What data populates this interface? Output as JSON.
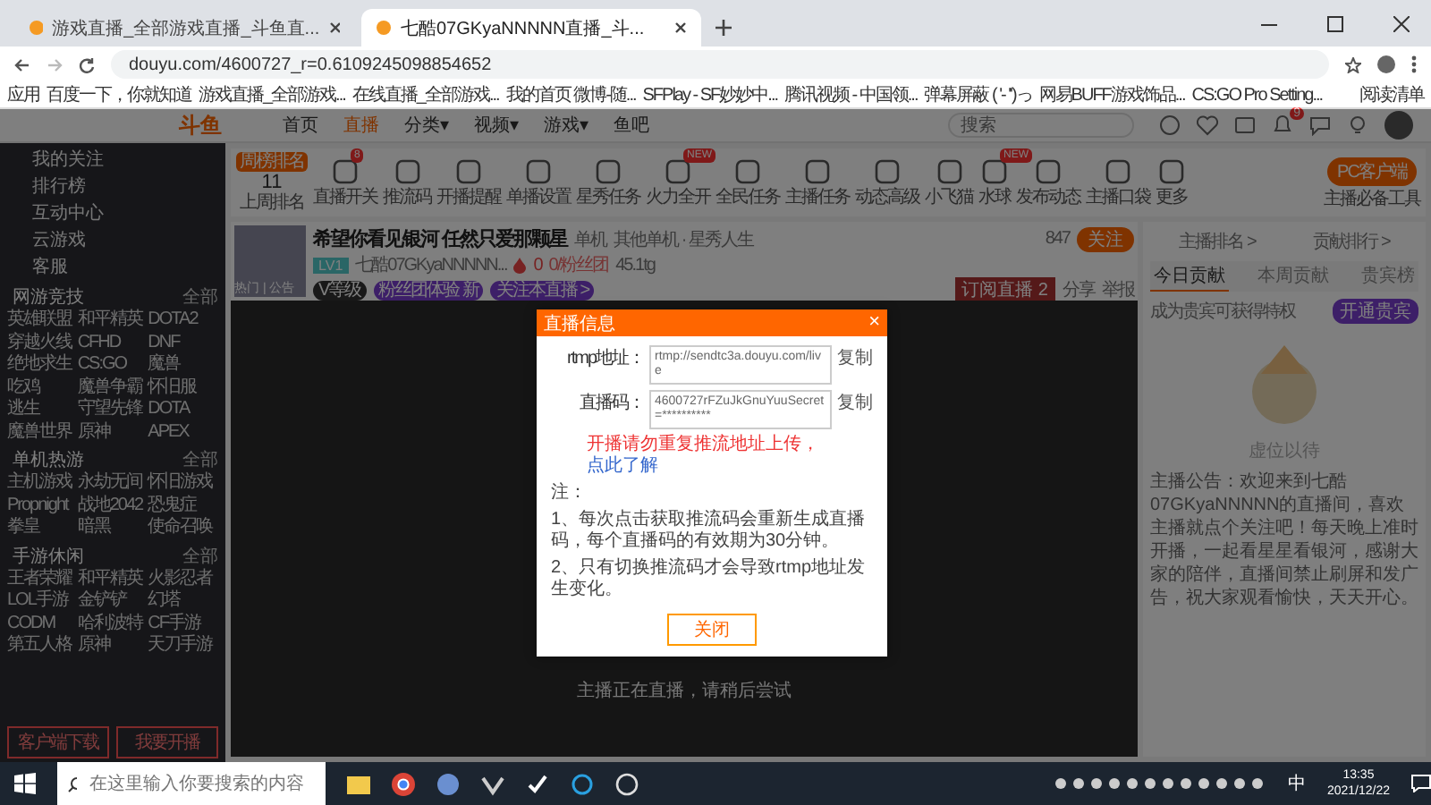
{
  "browser": {
    "tabs": [
      {
        "title": "游戏直播_全部游戏直播_斗鱼直...",
        "selected": false
      },
      {
        "title": "七酷07GKyaNNNNN直播_斗...",
        "selected": true
      }
    ],
    "url": "douyu.com/4600727_r=0.6109245098854652",
    "bookmarks": [
      "应用",
      "百度一下，你就知道",
      "游戏直播_全部游戏...",
      "在线直播_全部游戏...",
      "我的首页 微博-随...",
      "SFPlay - SF妙妙中...",
      "腾讯视频 - 中国领...",
      "弹幕屏蔽 ( '- '')っ",
      "网易BUFF游戏饰品...",
      "CS:GO Pro Setting..."
    ],
    "reading_list": "阅读清单"
  },
  "site_header": {
    "logo": "斗鱼",
    "nav": [
      {
        "label": "首页",
        "selected": false
      },
      {
        "label": "直播",
        "selected": true
      },
      {
        "label": "分类▾",
        "selected": false
      },
      {
        "label": "视频▾",
        "selected": false
      },
      {
        "label": "游戏▾",
        "selected": false
      },
      {
        "label": "鱼吧",
        "selected": false
      }
    ],
    "search": {
      "placeholder": "搜索"
    },
    "notification_badge": "9"
  },
  "sidebar": {
    "items": [
      "我的关注",
      "排行榜",
      "互动中心",
      "云游戏",
      "客服"
    ],
    "sections": [
      {
        "title": "网游竞技",
        "more": "全部",
        "games": [
          "英雄联盟",
          "和平精英",
          "DOTA2",
          "穿越火线",
          "CFHD",
          "DNF",
          "绝地求生",
          "CS:GO",
          "魔兽",
          "吃鸡",
          "魔兽争霸",
          "怀旧服",
          "逃生",
          "守望先锋",
          "DOTA",
          "魔兽世界",
          "原神",
          "APEX"
        ]
      },
      {
        "title": "单机热游",
        "more": "全部",
        "games": [
          "主机游戏",
          "永劫无间",
          "怀旧游戏",
          "Propnight",
          "战地2042",
          "恐鬼症",
          "拳皇",
          "暗黑",
          "使命召唤"
        ]
      },
      {
        "title": "手游休闲",
        "more": "全部",
        "games": [
          "王者荣耀",
          "和平精英",
          "火影忍者",
          "LOL手游",
          "金铲铲",
          "幻塔",
          "CODM",
          "哈利波特",
          "CF手游",
          "第五人格",
          "原神",
          "天刀手游"
        ]
      }
    ],
    "buttons": [
      "客户端下载",
      "我要开播"
    ]
  },
  "activity_bar": {
    "rank_badge": "周榜排名",
    "rank": "11",
    "rank_label": "上周排名",
    "items": [
      {
        "label": "直播开关",
        "badge": "8"
      },
      {
        "label": "推流码"
      },
      {
        "label": "开播提醒"
      },
      {
        "label": "单播设置"
      },
      {
        "label": "星秀任务"
      },
      {
        "label": "火力全开",
        "badge": "NEW"
      },
      {
        "label": "全民任务"
      },
      {
        "label": "主播任务"
      },
      {
        "label": "动态高级"
      },
      {
        "label": "小飞猫"
      },
      {
        "label": "水球",
        "badge": "NEW"
      },
      {
        "label": "发布动态"
      },
      {
        "label": "主播口袋"
      },
      {
        "label": "更多"
      }
    ],
    "pc_button": "PC客户端",
    "pc_caption": "主播必备工具"
  },
  "room": {
    "title": "希望你看见银河 任然只爱那颗星",
    "category": "单机",
    "category_path": "其他单机 · 星秀人生",
    "level_tag": "LV1",
    "streamer": "七酷07GKyaNNNNN...",
    "hot": "0",
    "fans": "0/粉丝团",
    "viewers": "45.1tg",
    "avatar_caption": "热门 | 公告",
    "badges": [
      "V等级",
      "粉丝团体验 新",
      "关注本直播 >"
    ],
    "follow_count": "847",
    "follow_button": "关注",
    "gift_button": "订阅直播 2",
    "share": "分享",
    "report": "举报"
  },
  "player": {
    "message": "主播正在直播，请稍后尝试"
  },
  "right_panel": {
    "tabs_top": [
      "主播排名 >",
      "贡献排行 >"
    ],
    "tabs": [
      {
        "label": "今日贡献",
        "selected": true
      },
      {
        "label": "本周贡献",
        "selected": false
      },
      {
        "label": "贵宾榜",
        "selected": false
      }
    ],
    "hint": "成为贵宾可获得特权",
    "vip_button": "开通贵宾",
    "caption": "虚位以待",
    "notice": "主播公告：欢迎来到七酷07GKyaNNNNN的直播间，喜欢主播就点个关注吧！每天晚上准时开播，一起看星星看银河，感谢大家的陪伴，直播间禁止刷屏和发广告，祝大家观看愉快，天天开心。"
  },
  "dialog": {
    "title": "直播信息",
    "close": "×",
    "rows": [
      {
        "label": "rtmp地址：",
        "value": "rtmp://sendtc3a.douyu.com/live",
        "copy": "复制"
      },
      {
        "label": "直播码：",
        "value": "4600727rFZuJkGnuYuuSecret=**********",
        "copy": "复制"
      }
    ],
    "warning": "开播请勿重复推流地址上传，",
    "warning_link": "点此了解",
    "notes": [
      "注：",
      "1、每次点击获取推流码会重新生成直播码，每个直播码的有效期为30分钟。",
      "2、只有切换推流码才会导致rtmp地址发生变化。"
    ],
    "button": "关闭"
  },
  "taskbar": {
    "search": {
      "placeholder": "在这里输入你要搜索的内容"
    },
    "time": "13:35",
    "date": "2021/12/22",
    "ime": "中"
  }
}
